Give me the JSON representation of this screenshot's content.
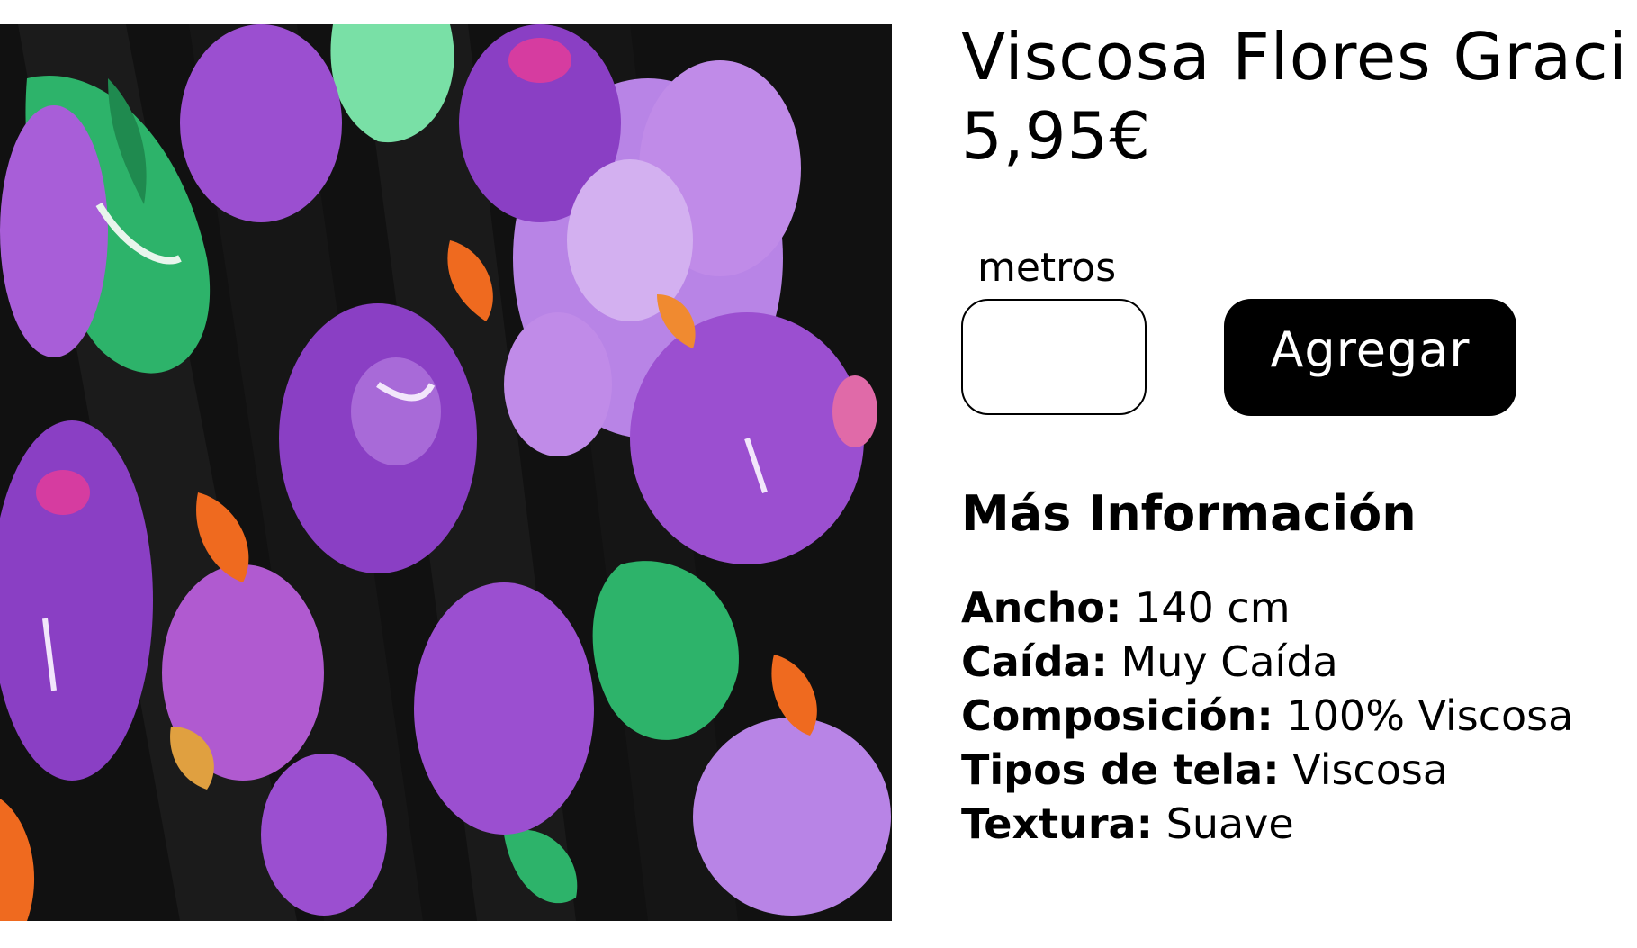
{
  "product": {
    "title": "Viscosa Flores Graci",
    "price": "5,95€",
    "image_icon": "floral-fabric-photo"
  },
  "quantity": {
    "label": "metros",
    "value": "",
    "placeholder": ""
  },
  "actions": {
    "add_label": "Agregar"
  },
  "more_info": {
    "heading": "Más Información",
    "specs": [
      {
        "key": "Ancho:",
        "value": " 140 cm"
      },
      {
        "key": "Caída:",
        "value": " Muy Caída"
      },
      {
        "key": "Composición:",
        "value": " 100% Viscosa"
      },
      {
        "key": "Tipos de tela:",
        "value": " Viscosa"
      },
      {
        "key": "Textura:",
        "value": " Suave"
      }
    ]
  },
  "colors": {
    "button_bg": "#000000",
    "button_text": "#ffffff",
    "fabric_base": "#101010",
    "fabric_purple": "#9b4fd0",
    "fabric_lilac": "#c08be8",
    "fabric_green": "#2db36a",
    "fabric_mint": "#79e0a6",
    "fabric_orange": "#ef6a1f",
    "fabric_magenta": "#d63ca0"
  }
}
